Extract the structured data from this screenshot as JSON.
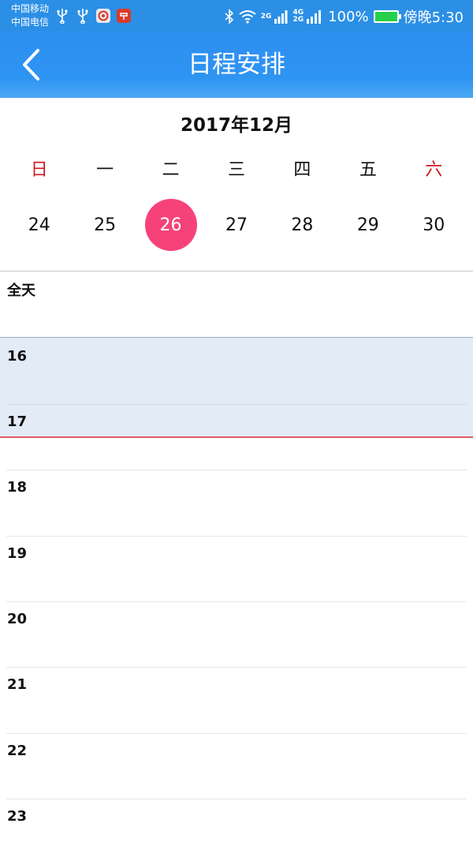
{
  "status_bar": {
    "carrier_1": "中国移动",
    "carrier_2": "中国电信",
    "network_1": "2G",
    "network_2_top": "4G",
    "network_2_bottom": "2G",
    "battery": "100%",
    "time": "傍晚5:30",
    "battery_color": "#26d04a"
  },
  "header": {
    "title": "日程安排",
    "back_icon": "chevron-left-icon",
    "bg_color": "#2e94f2"
  },
  "calendar": {
    "month_title": "2017年12月",
    "weekdays": [
      "日",
      "一",
      "二",
      "三",
      "四",
      "五",
      "六"
    ],
    "dates": [
      "24",
      "25",
      "26",
      "27",
      "28",
      "29",
      "30"
    ],
    "selected_date": "26",
    "selected_color": "#f5437a",
    "weekend_color": "#d0171e"
  },
  "schedule": {
    "all_day_label": "全天",
    "hours": [
      "16",
      "17",
      "18",
      "19",
      "20",
      "21",
      "22",
      "23"
    ],
    "highlight_color": "#e3ebf7",
    "current_time_color": "#e05a63"
  }
}
